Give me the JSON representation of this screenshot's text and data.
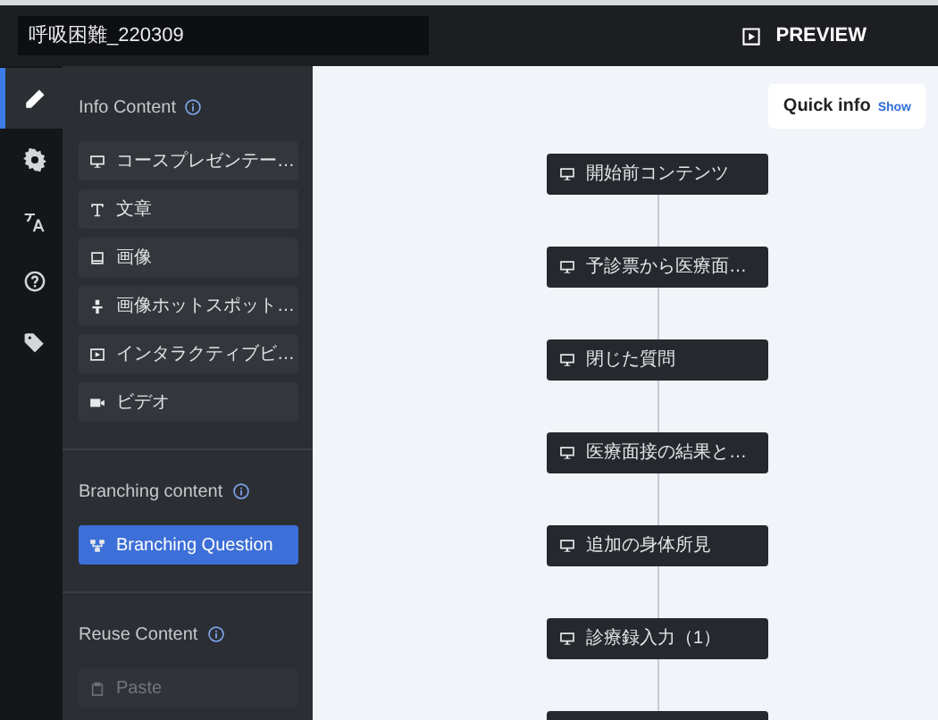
{
  "header": {
    "title": "呼吸困難_220309",
    "preview": "PREVIEW"
  },
  "rail": [
    {
      "kind": "edit",
      "selected": true
    },
    {
      "kind": "settings",
      "selected": false
    },
    {
      "kind": "translate",
      "selected": false
    },
    {
      "kind": "help",
      "selected": false
    },
    {
      "kind": "tag",
      "selected": false
    }
  ],
  "sidebar": [
    {
      "title": "Info Content",
      "items": [
        {
          "kind": "presentation",
          "label": "コースプレゼンテー…"
        },
        {
          "kind": "text",
          "label": "文章"
        },
        {
          "kind": "image",
          "label": "画像"
        },
        {
          "kind": "hotspot",
          "label": "画像ホットスポット…"
        },
        {
          "kind": "interactive-video",
          "label": "インタラクティブビ…"
        },
        {
          "kind": "video",
          "label": "ビデオ"
        }
      ]
    },
    {
      "title": "Branching content",
      "items": [
        {
          "kind": "branching",
          "label": "Branching Question"
        }
      ]
    },
    {
      "title": "Reuse Content",
      "items": [
        {
          "kind": "paste",
          "label": "Paste"
        }
      ]
    }
  ],
  "quick_info": {
    "title": "Quick info",
    "link": "Show"
  },
  "nodes": [
    {
      "label": "開始前コンテンツ"
    },
    {
      "label": "予診票から医療面…"
    },
    {
      "label": "閉じた質問"
    },
    {
      "label": "医療面接の結果と…"
    },
    {
      "label": "追加の身体所見"
    },
    {
      "label": "診療録入力（1）"
    }
  ],
  "nodes_continue_below": true
}
